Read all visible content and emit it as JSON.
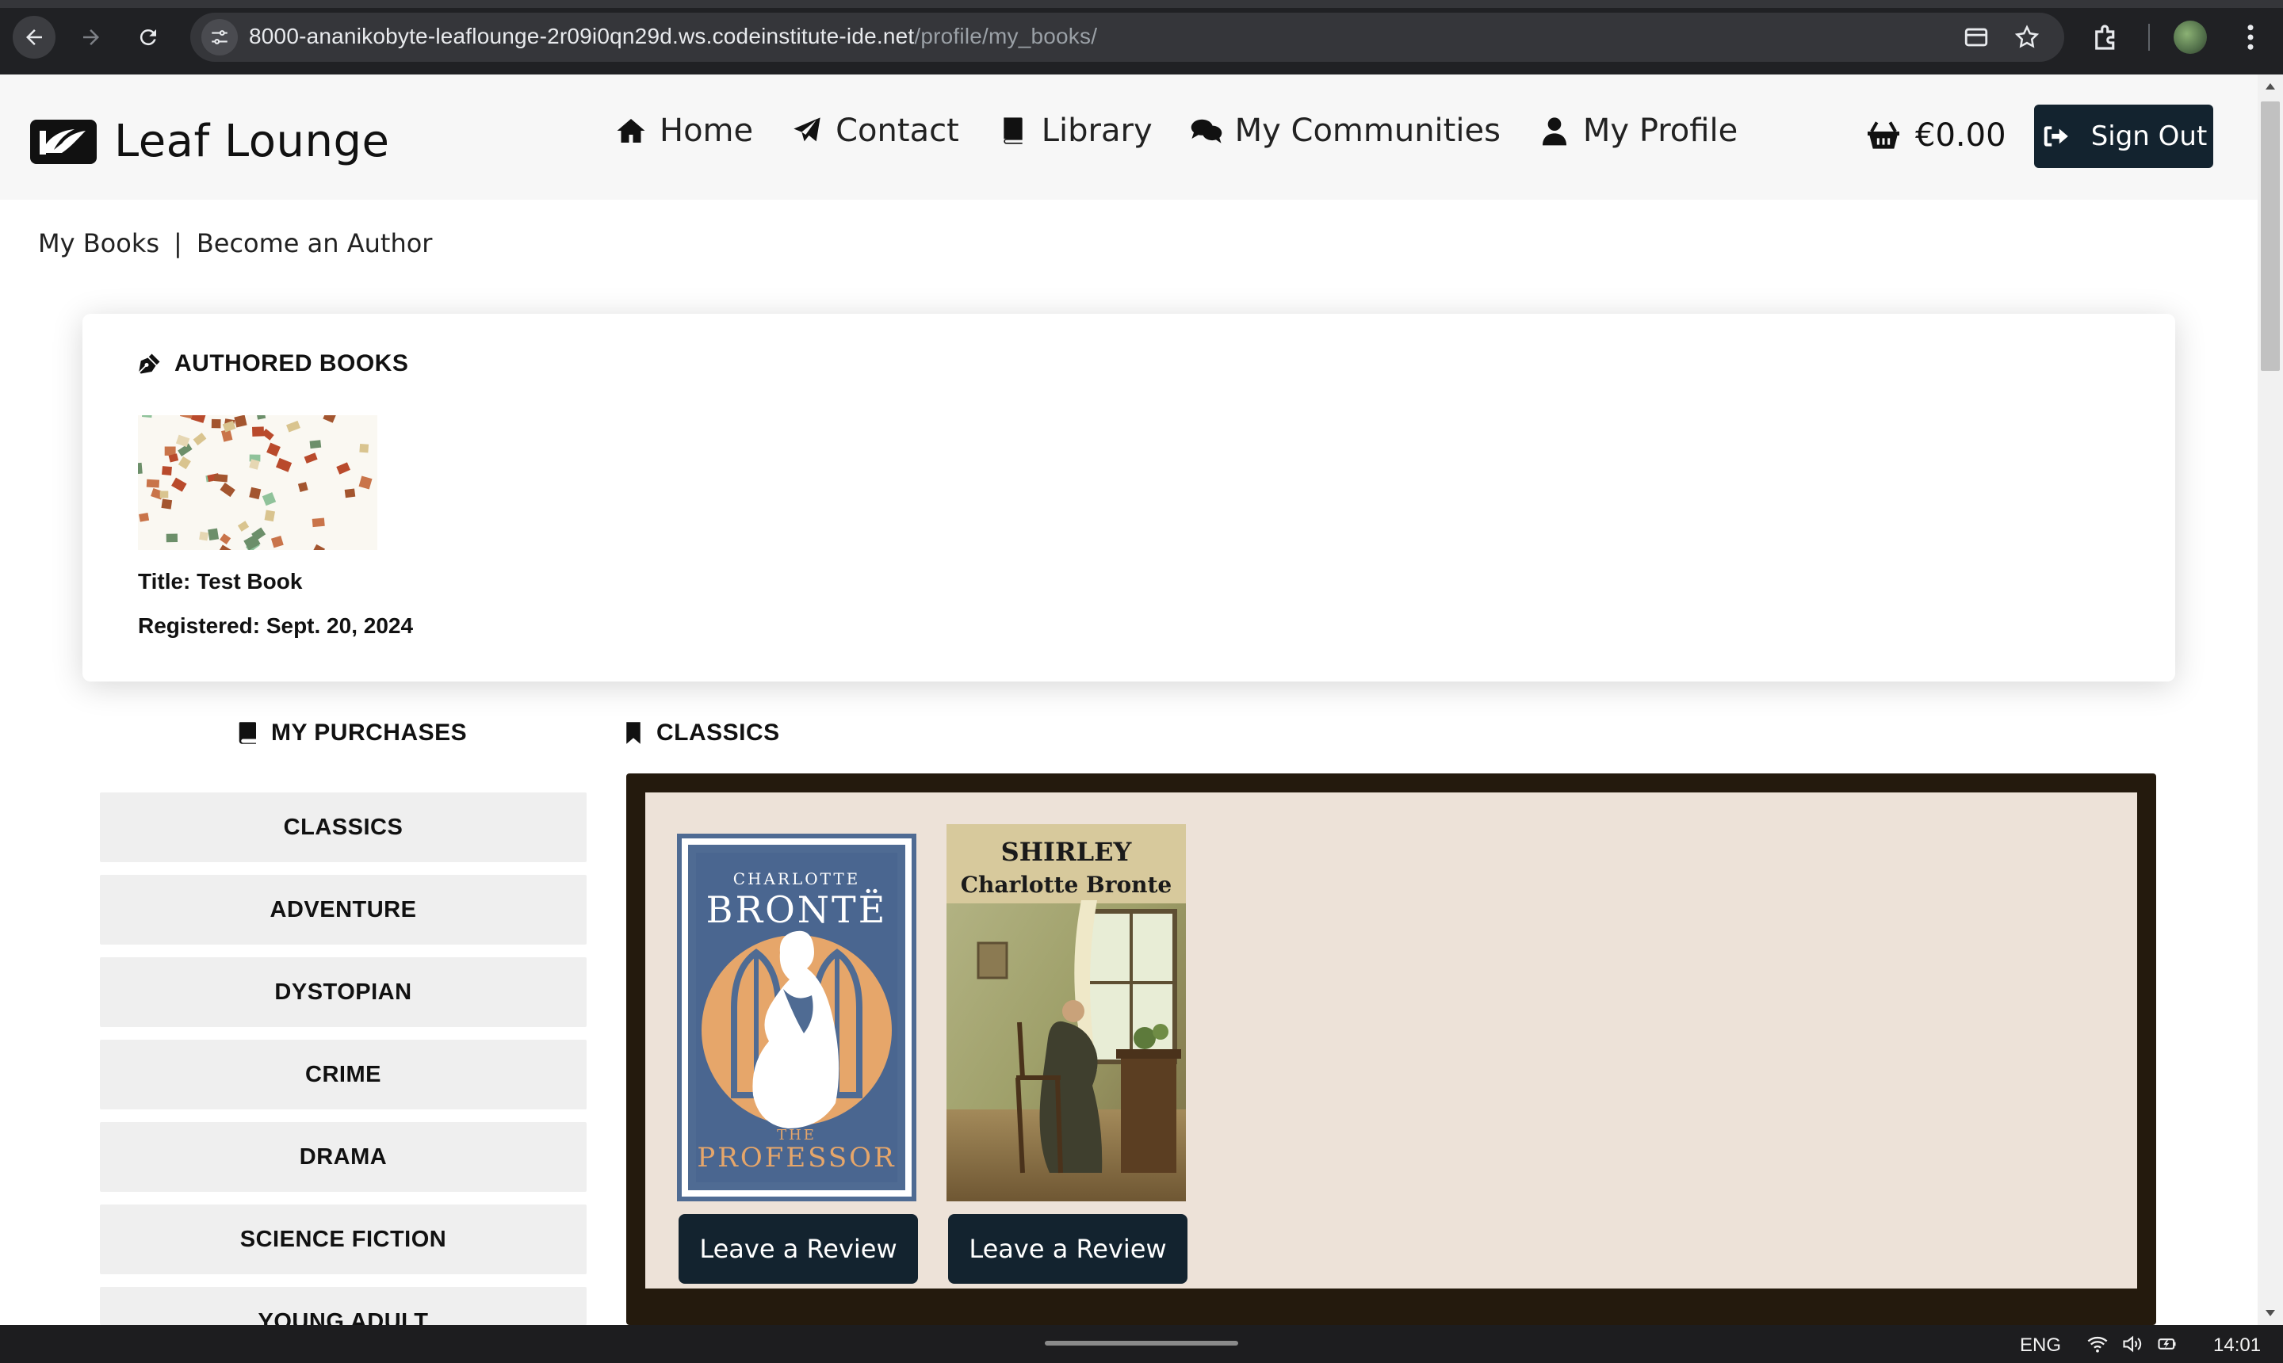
{
  "browser": {
    "url_host": "8000-ananikobyte-leaflounge-2r09i0qn29d.ws.codeinstitute-ide.net",
    "url_path": "/profile/my_books/"
  },
  "site": {
    "brand": "Leaf Lounge",
    "menu": [
      {
        "label": "Home",
        "icon": "home-icon"
      },
      {
        "label": "Contact",
        "icon": "paper-plane-icon"
      },
      {
        "label": "Library",
        "icon": "book-icon"
      },
      {
        "label": "My Communities",
        "icon": "comments-icon"
      },
      {
        "label": "My Profile",
        "icon": "user-icon"
      }
    ],
    "basket_total": "€0.00",
    "sign_out": "Sign Out"
  },
  "subnav": {
    "my_books": "My Books",
    "separator": "|",
    "become_author": "Become an Author"
  },
  "authored": {
    "heading": "AUTHORED BOOKS",
    "title_line": "Title: Test Book",
    "registered_line": "Registered: Sept. 20, 2024"
  },
  "purchases": {
    "heading": "MY PURCHASES",
    "genres": [
      "CLASSICS",
      "ADVENTURE",
      "DYSTOPIAN",
      "CRIME",
      "DRAMA",
      "SCIENCE FICTION",
      "YOUNG ADULT"
    ]
  },
  "shelf": {
    "heading": "CLASSICS",
    "books": [
      {
        "cover_top": "CHARLOTTE",
        "cover_name": "BRONTË",
        "cover_the": "THE",
        "cover_title": "PROFESSOR",
        "review_label": "Leave a Review"
      },
      {
        "cover_title": "SHIRLEY",
        "cover_author": "Charlotte Bronte",
        "review_label": "Leave a Review"
      }
    ]
  },
  "taskbar": {
    "lang": "ENG",
    "time": "14:01"
  },
  "colors": {
    "nav_dark": "#13232f",
    "shelf_frame": "#241a0d",
    "shelf_bg": "#ede2d8",
    "professor_blue": "#4f6b93",
    "professor_orange": "#e6a66a"
  }
}
